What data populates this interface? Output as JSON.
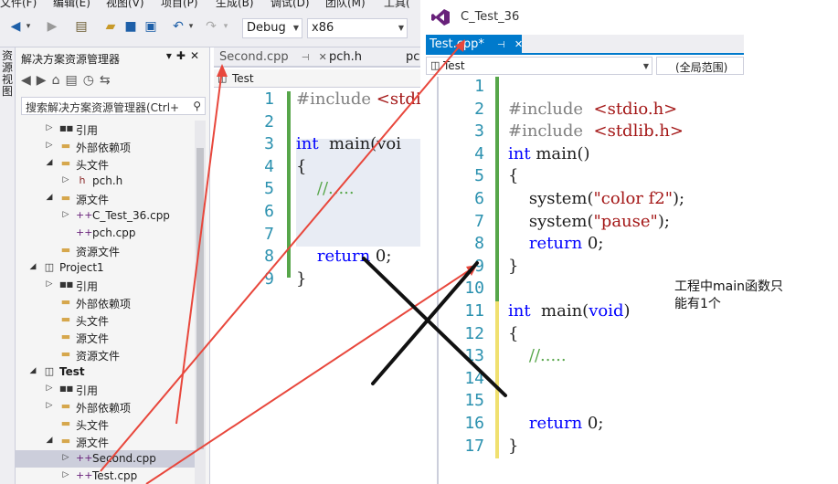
{
  "menubar": {
    "items": [
      "文件(F)",
      "编辑(E)",
      "视图(V)",
      "项目(P)",
      "生成(B)",
      "调试(D)",
      "团队(M)",
      "工具("
    ]
  },
  "toolbar": {
    "config": "Debug",
    "platform": "x86"
  },
  "sidetab": {
    "label": "资源视图"
  },
  "explorer": {
    "title": "解决方案资源管理器",
    "search_placeholder": "搜索解决方案资源管理器(Ctrl+",
    "tree": [
      {
        "label": "引用",
        "level": 2,
        "icon": "reference-icon",
        "expanded": false
      },
      {
        "label": "外部依赖项",
        "level": 2,
        "icon": "folder-icon",
        "expanded": false
      },
      {
        "label": "头文件",
        "level": 2,
        "icon": "folder-icon",
        "expanded": true
      },
      {
        "label": "pch.h",
        "level": 3,
        "icon": "header-file-icon",
        "expanded": false
      },
      {
        "label": "源文件",
        "level": 2,
        "icon": "folder-icon",
        "expanded": true
      },
      {
        "label": "C_Test_36.cpp",
        "level": 3,
        "icon": "cpp-file-icon",
        "expanded": false
      },
      {
        "label": "pch.cpp",
        "level": 3,
        "icon": "cpp-file-icon",
        "leaf": true
      },
      {
        "label": "资源文件",
        "level": 2,
        "icon": "folder-icon",
        "leaf": true
      },
      {
        "label": "Project1",
        "level": 1,
        "icon": "project-icon",
        "expanded": true
      },
      {
        "label": "引用",
        "level": 2,
        "icon": "reference-icon",
        "expanded": false
      },
      {
        "label": "外部依赖项",
        "level": 2,
        "icon": "folder-icon",
        "leaf": true
      },
      {
        "label": "头文件",
        "level": 2,
        "icon": "folder-icon",
        "leaf": true
      },
      {
        "label": "源文件",
        "level": 2,
        "icon": "folder-icon",
        "leaf": true
      },
      {
        "label": "资源文件",
        "level": 2,
        "icon": "folder-icon",
        "leaf": true
      },
      {
        "label": "Test",
        "level": 1,
        "icon": "project-icon",
        "expanded": true,
        "bold": true
      },
      {
        "label": "引用",
        "level": 2,
        "icon": "reference-icon",
        "expanded": false
      },
      {
        "label": "外部依赖项",
        "level": 2,
        "icon": "folder-icon",
        "expanded": false
      },
      {
        "label": "头文件",
        "level": 2,
        "icon": "folder-icon",
        "leaf": true
      },
      {
        "label": "源文件",
        "level": 2,
        "icon": "folder-icon",
        "expanded": true
      },
      {
        "label": "Second.cpp",
        "level": 3,
        "icon": "cpp-file-icon",
        "expanded": false,
        "selected": true
      },
      {
        "label": "Test.cpp",
        "level": 3,
        "icon": "cpp-file-icon",
        "expanded": false
      }
    ]
  },
  "left_editor": {
    "tabs": [
      {
        "label": "Second.cpp",
        "active": true
      },
      {
        "label": "pch.h"
      },
      {
        "label": "pcl"
      }
    ],
    "nav_scope": "Test",
    "line_numbers": [
      "1",
      "2",
      "3",
      "4",
      "5",
      "6",
      "7",
      "8",
      "9"
    ],
    "code": [
      "#include <stdi",
      "",
      "int  main(voi",
      "{",
      "    //.....",
      "",
      "",
      "    return 0;",
      "}"
    ]
  },
  "right_window": {
    "title": "C_Test_36",
    "active_tab": "Test.cpp*",
    "nav_scope": "Test",
    "nav_scope2": "(全局范围)",
    "line_numbers": [
      "1",
      "2",
      "3",
      "4",
      "5",
      "6",
      "7",
      "8",
      "9",
      "10",
      "11",
      "12",
      "13",
      "14",
      "15",
      "16",
      "17"
    ],
    "code": [
      "",
      "#include  <stdio.h>",
      "#include  <stdlib.h>",
      "int main()",
      "{",
      "    system(\"color f2\");",
      "    system(\"pause\");",
      "    return 0;",
      "}",
      "",
      "int  main(void)",
      "{",
      "    //.....",
      "",
      "",
      "    return 0;",
      "}"
    ]
  },
  "annotation": {
    "line1": "工程中main函数只",
    "line2": "能有1个"
  },
  "colors": {
    "keyword": "#0000ff",
    "string": "#a31515",
    "comment": "#57a64a",
    "line_number": "#2b91af",
    "accent": "#007acc",
    "arrow": "#e8473c"
  }
}
